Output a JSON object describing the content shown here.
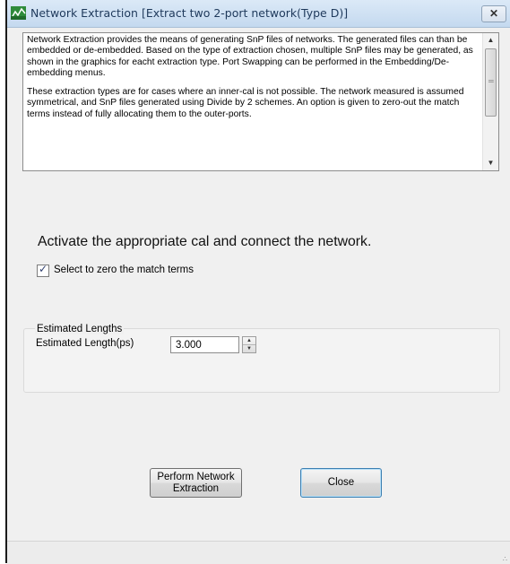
{
  "window": {
    "title": "Network Extraction [Extract two 2-port network(Type D)]",
    "close_label": "✕"
  },
  "description": {
    "paragraph1": "Network Extraction provides the means of generating SnP files of networks.  The generated files can than be embedded or de-embedded.  Based on the type of extraction chosen, multiple SnP files may be generated, as shown in the graphics for eacht extraction type.  Port Swapping can be performed in the Embedding/De-embedding menus.",
    "paragraph2": "These extraction types are for cases where an inner-cal is not possible.  The network measured is assumed symmetrical, and  SnP files generated using Divide by 2 schemes.  An option is given to zero-out the match terms instead of fully allocating them to the outer-ports."
  },
  "instruction": "Activate the appropriate cal and connect the network.",
  "zero_match": {
    "label": "Select to zero the match terms",
    "checked": true
  },
  "estimated_lengths": {
    "group_title": "Estimated Lengths",
    "label": "Estimated Length(ps)",
    "value": "3.000"
  },
  "buttons": {
    "perform": "Perform Network Extraction",
    "close": "Close"
  },
  "colors": {
    "titlebar": "#c4d9ef",
    "accent_border": "#3c7fb1"
  },
  "icons": {
    "app": "network-extraction-icon",
    "close": "close-icon",
    "scroll_up": "scroll-up-arrow-icon",
    "scroll_down": "scroll-down-arrow-icon",
    "spin_up": "spin-up-arrow-icon",
    "spin_down": "spin-down-arrow-icon",
    "resize": "resize-grip-icon"
  }
}
